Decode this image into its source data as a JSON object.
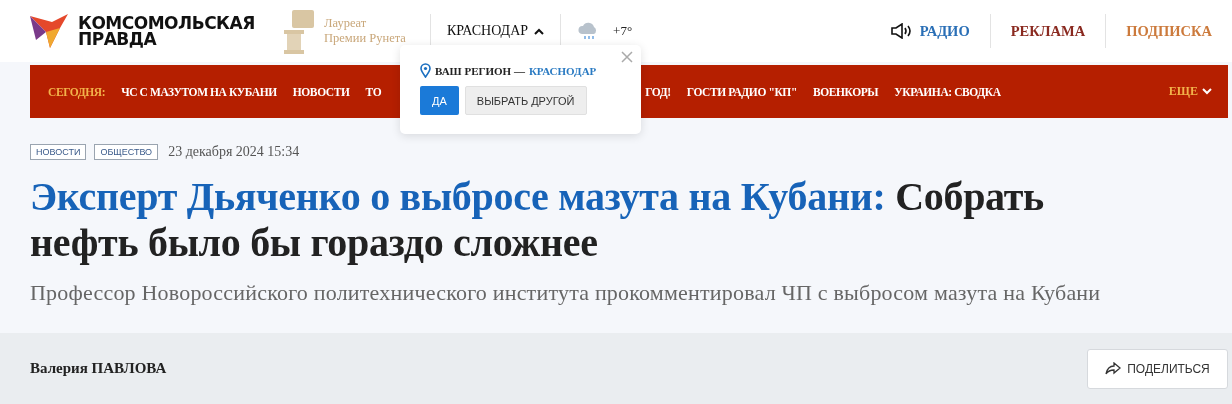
{
  "header": {
    "logo_line_1": "КОМСОМОЛЬСКАЯ",
    "logo_line_2": "ПРАВДА",
    "award_line_1": "Лауреат",
    "award_line_2": "Премии Рунета",
    "city": "КРАСНОДАР",
    "city_expanded": true,
    "temperature": "+7°",
    "links": [
      {
        "label": "РАДИО",
        "kind": "radio"
      },
      {
        "label": "РЕКЛАМА",
        "kind": "ad"
      },
      {
        "label": "ПОДПИСКА",
        "kind": "subscribe"
      }
    ]
  },
  "nav": {
    "today_label": "СЕГОДНЯ:",
    "items_left": [
      "ЧС С МАЗУТОМ НА КУБАНИ",
      "НОВОСТИ",
      "ТО"
    ],
    "items_right": [
      "ГОД!",
      "ГОСТИ РАДИО \"КП\"",
      "ВОЕНКОРЫ",
      "УКРАИНА: СВОДКА"
    ],
    "more": "ЕЩЕ"
  },
  "region_popup": {
    "label": "ВАШ РЕГИОН —",
    "region": "КРАСНОДАР",
    "confirm": "ДА",
    "other": "ВЫБРАТЬ ДРУГОЙ"
  },
  "article": {
    "tags": [
      "НОВОСТИ",
      "ОБЩЕСТВО"
    ],
    "date": "23 декабря 2024 15:34",
    "title_lead": "Эксперт Дьяченко о выбросе мазута на Кубани:",
    "title_rest": "Собрать нефть было бы гораздо сложнее",
    "subtitle": "Профессор Новороссийского политехнического института прокомментировал ЧП с выбросом мазута на Кубани",
    "author": "Валерия ПАВЛОВА",
    "share": "ПОДЕЛИТЬСЯ"
  }
}
